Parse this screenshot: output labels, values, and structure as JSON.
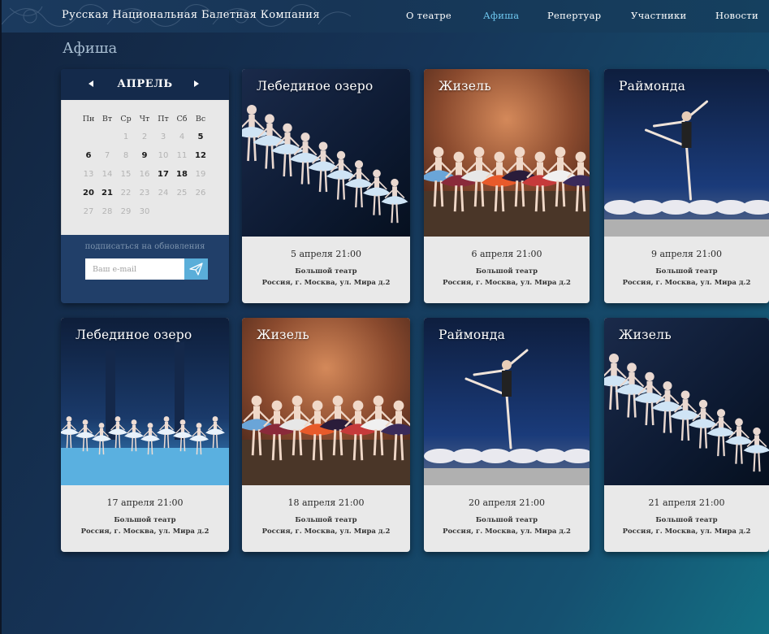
{
  "header": {
    "site_title": "Русская Национальная Балетная Компания",
    "nav": [
      "О театре",
      "Афиша",
      "Репертуар",
      "Участники",
      "Новости"
    ],
    "active_nav": "Афиша"
  },
  "page_title": "Афиша",
  "calendar": {
    "month": "АПРЕЛЬ",
    "weekdays": [
      "Пн",
      "Вт",
      "Ср",
      "Чт",
      "Пт",
      "Сб",
      "Вс"
    ],
    "weeks": [
      [
        "",
        "",
        "1",
        "2",
        "3",
        "4",
        "5"
      ],
      [
        "6",
        "7",
        "8",
        "9",
        "10",
        "11",
        "12"
      ],
      [
        "13",
        "14",
        "15",
        "16",
        "17",
        "18",
        "19"
      ],
      [
        "20",
        "21",
        "22",
        "23",
        "24",
        "25",
        "26"
      ],
      [
        "27",
        "28",
        "29",
        "30",
        "",
        "",
        ""
      ]
    ],
    "event_days": [
      "5",
      "6",
      "9",
      "12",
      "17",
      "18",
      "20",
      "21"
    ],
    "subscribe_label": "подписаться на обновления",
    "email_placeholder": "Ваш e-mail"
  },
  "events": [
    {
      "title": "Лебединое озеро",
      "date": "5 апреля 21:00",
      "venue": "Большой театр",
      "address": "Россия, г. Москва, ул. Мира д.2",
      "image": "swan-lake-line"
    },
    {
      "title": "Жизель",
      "date": "6 апреля 21:00",
      "venue": "Большой театр",
      "address": "Россия, г. Москва, ул. Мира д.2",
      "image": "giselle-folk"
    },
    {
      "title": "Раймонда",
      "date": "9 апреля 21:00",
      "venue": "Большой театр",
      "address": "Россия, г. Москва, ул. Мира д.2",
      "image": "raymonda-leap"
    },
    {
      "title": "Лебединое озеро",
      "date": "17 апреля 21:00",
      "venue": "Большой театр",
      "address": "Россия, г. Москва, ул. Мира д.2",
      "image": "swan-lake-stage"
    },
    {
      "title": "Жизель",
      "date": "18 апреля 21:00",
      "venue": "Большой театр",
      "address": "Россия, г. Москва, ул. Мира д.2",
      "image": "giselle-folk"
    },
    {
      "title": "Раймонда",
      "date": "20 апреля 21:00",
      "venue": "Большой театр",
      "address": "Россия, г. Москва, ул. Мира д.2",
      "image": "raymonda-leap"
    },
    {
      "title": "Жизель",
      "date": "21 апреля 21:00",
      "venue": "Большой театр",
      "address": "Россия, г. Москва, ул. Мира д.2",
      "image": "swan-lake-line"
    }
  ],
  "colors": {
    "background": "#163457",
    "header": "#1b3a5e",
    "active_nav": "#6ec6ee",
    "card": "#e9e9e9",
    "send_button": "#5aaed9"
  }
}
